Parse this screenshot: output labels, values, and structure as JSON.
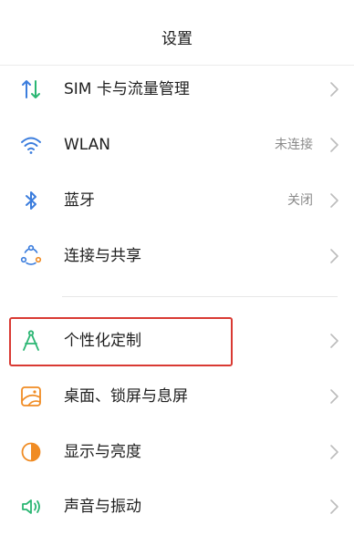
{
  "header": {
    "title": "设置"
  },
  "items": [
    {
      "label": "SIM 卡与流量管理",
      "value": "",
      "icon": "sim-data-icon"
    },
    {
      "label": "WLAN",
      "value": "未连接",
      "icon": "wifi-icon"
    },
    {
      "label": "蓝牙",
      "value": "关闭",
      "icon": "bluetooth-icon"
    },
    {
      "label": "连接与共享",
      "value": "",
      "icon": "connection-share-icon"
    },
    {
      "label": "个性化定制",
      "value": "",
      "icon": "compass-icon"
    },
    {
      "label": "桌面、锁屏与息屏",
      "value": "",
      "icon": "wallpaper-icon"
    },
    {
      "label": "显示与亮度",
      "value": "",
      "icon": "brightness-icon"
    },
    {
      "label": "声音与振动",
      "value": "",
      "icon": "speaker-icon"
    }
  ],
  "colors": {
    "accent_green": "#2bb673",
    "accent_blue": "#3b7ddd",
    "accent_orange": "#f08c24",
    "highlight_red": "#d93a33",
    "chevron": "#bcbcbc",
    "secondary_text": "#8a8a8a"
  }
}
